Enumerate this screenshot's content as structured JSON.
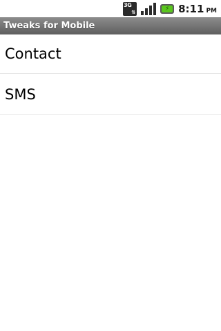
{
  "status_bar": {
    "network_type": "3G",
    "network_icon": "3g-data-icon",
    "signal_icon": "signal-strength-icon",
    "battery_icon": "battery-charging-icon",
    "time": "8:11",
    "ampm": "PM"
  },
  "title_bar": {
    "title": "Tweaks for Mobile"
  },
  "list": {
    "items": [
      {
        "label": "Contact"
      },
      {
        "label": "SMS"
      }
    ]
  },
  "colors": {
    "title_bar_top": "#8c8c8c",
    "title_bar_bottom": "#5f5f5f",
    "battery_green": "#5ac71e",
    "divider": "#e5e5e5"
  }
}
